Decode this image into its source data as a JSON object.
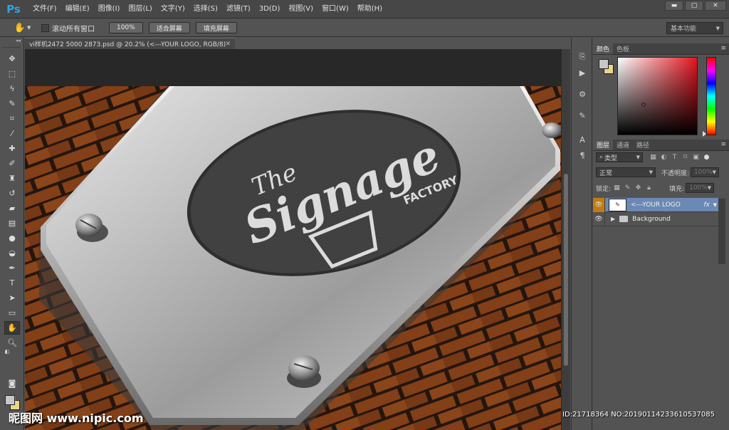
{
  "app": {
    "logo": "Ps"
  },
  "menu": [
    "文件(F)",
    "编辑(E)",
    "图像(I)",
    "图层(L)",
    "文字(Y)",
    "选择(S)",
    "滤镜(T)",
    "3D(D)",
    "视图(V)",
    "窗口(W)",
    "帮助(H)"
  ],
  "options": {
    "scroll_all_label": "滚动所有窗口",
    "zoom_100": "100%",
    "fit_screen": "适合屏幕",
    "fill_screen": "填充屏幕",
    "workspace": "基本功能"
  },
  "document": {
    "tab_title": "vi样机2472 5000 2873.psd @ 20.2% (<---YOUR LOGO, RGB/8)",
    "logo_text": {
      "line1": "The",
      "line2": "Signage",
      "line3": "FACTORY"
    }
  },
  "color_panel": {
    "tabs": [
      "颜色",
      "色板"
    ],
    "fg": "#c7c7c7",
    "bg": "#ecd48a"
  },
  "layers_panel": {
    "tabs": [
      "图层",
      "通道",
      "路径"
    ],
    "filter_kind": "类型",
    "blend_mode": "正常",
    "opacity_label": "不透明度:",
    "opacity_value": "100%",
    "lock_label": "锁定:",
    "fill_label": "填充:",
    "fill_value": "100%",
    "layers": [
      {
        "name": "<---YOUR LOGO",
        "selected": true,
        "fx": "fx"
      },
      {
        "name": "Background",
        "selected": false
      }
    ]
  },
  "watermark": {
    "site": "昵图网 www.nipic.com",
    "id": "ID:21718364 NO:20190114233610537085"
  }
}
